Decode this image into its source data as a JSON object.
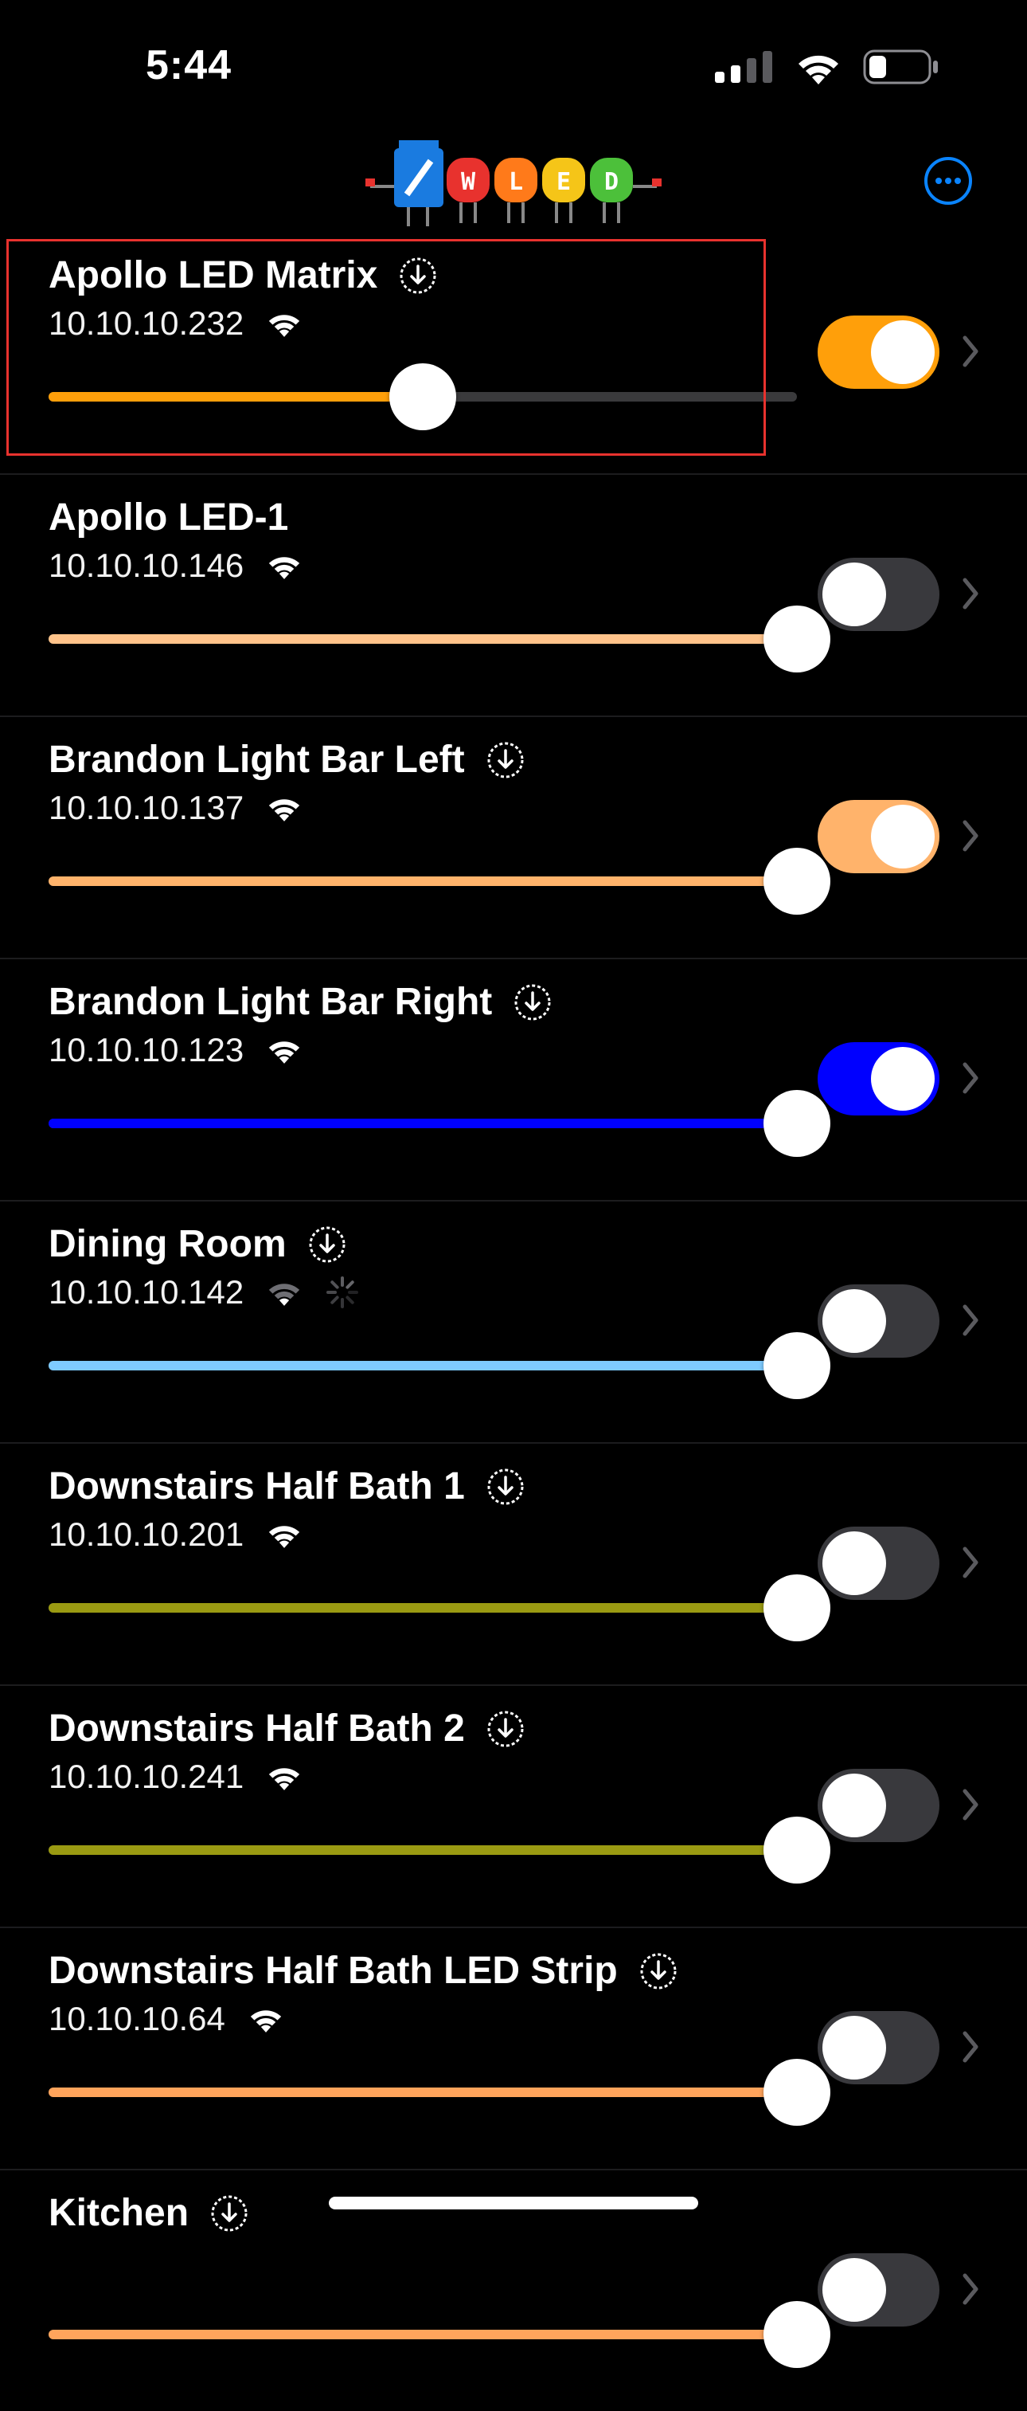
{
  "status_bar": {
    "time": "5:44",
    "battery_level": 0.3
  },
  "header": {
    "logo_text": "WLED",
    "accent_color": "#0a84ff"
  },
  "devices": [
    {
      "name": "Apollo LED Matrix",
      "ip": "10.10.10.232",
      "update_available": true,
      "signal": "strong",
      "loading": false,
      "on": true,
      "brightness": 0.5,
      "color": "#ff9f0a",
      "toggle_color": "#ff9f0a",
      "selected": true
    },
    {
      "name": "Apollo LED-1",
      "ip": "10.10.10.146",
      "update_available": false,
      "signal": "strong",
      "loading": false,
      "on": false,
      "brightness": 1.0,
      "color": "#ffc38a",
      "toggle_color": "#39393d",
      "selected": false
    },
    {
      "name": "Brandon Light Bar Left",
      "ip": "10.10.10.137",
      "update_available": true,
      "signal": "strong",
      "loading": false,
      "on": true,
      "brightness": 1.0,
      "color": "#ffb36b",
      "toggle_color": "#ffb36b",
      "selected": false
    },
    {
      "name": "Brandon Light Bar Right",
      "ip": "10.10.10.123",
      "update_available": true,
      "signal": "strong",
      "loading": false,
      "on": true,
      "brightness": 1.0,
      "color": "#0000ff",
      "toggle_color": "#0000ff",
      "selected": false
    },
    {
      "name": "Dining Room",
      "ip": "10.10.10.142",
      "update_available": true,
      "signal": "weak",
      "loading": true,
      "on": false,
      "brightness": 1.0,
      "color": "#7ecbff",
      "toggle_color": "#39393d",
      "selected": false
    },
    {
      "name": "Downstairs Half Bath 1",
      "ip": "10.10.10.201",
      "update_available": true,
      "signal": "strong",
      "loading": false,
      "on": false,
      "brightness": 1.0,
      "color": "#9a9a12",
      "toggle_color": "#39393d",
      "selected": false
    },
    {
      "name": "Downstairs Half Bath 2",
      "ip": "10.10.10.241",
      "update_available": true,
      "signal": "strong",
      "loading": false,
      "on": false,
      "brightness": 1.0,
      "color": "#9a9a12",
      "toggle_color": "#39393d",
      "selected": false
    },
    {
      "name": "Downstairs Half Bath LED Strip",
      "ip": "10.10.10.64",
      "update_available": true,
      "signal": "strong",
      "loading": false,
      "on": false,
      "brightness": 1.0,
      "color": "#ffa45c",
      "toggle_color": "#39393d",
      "selected": false
    },
    {
      "name": "Kitchen",
      "ip": "",
      "update_available": true,
      "signal": "strong",
      "loading": false,
      "on": false,
      "brightness": 1.0,
      "color": "#ffa45c",
      "toggle_color": "#39393d",
      "selected": false
    }
  ]
}
